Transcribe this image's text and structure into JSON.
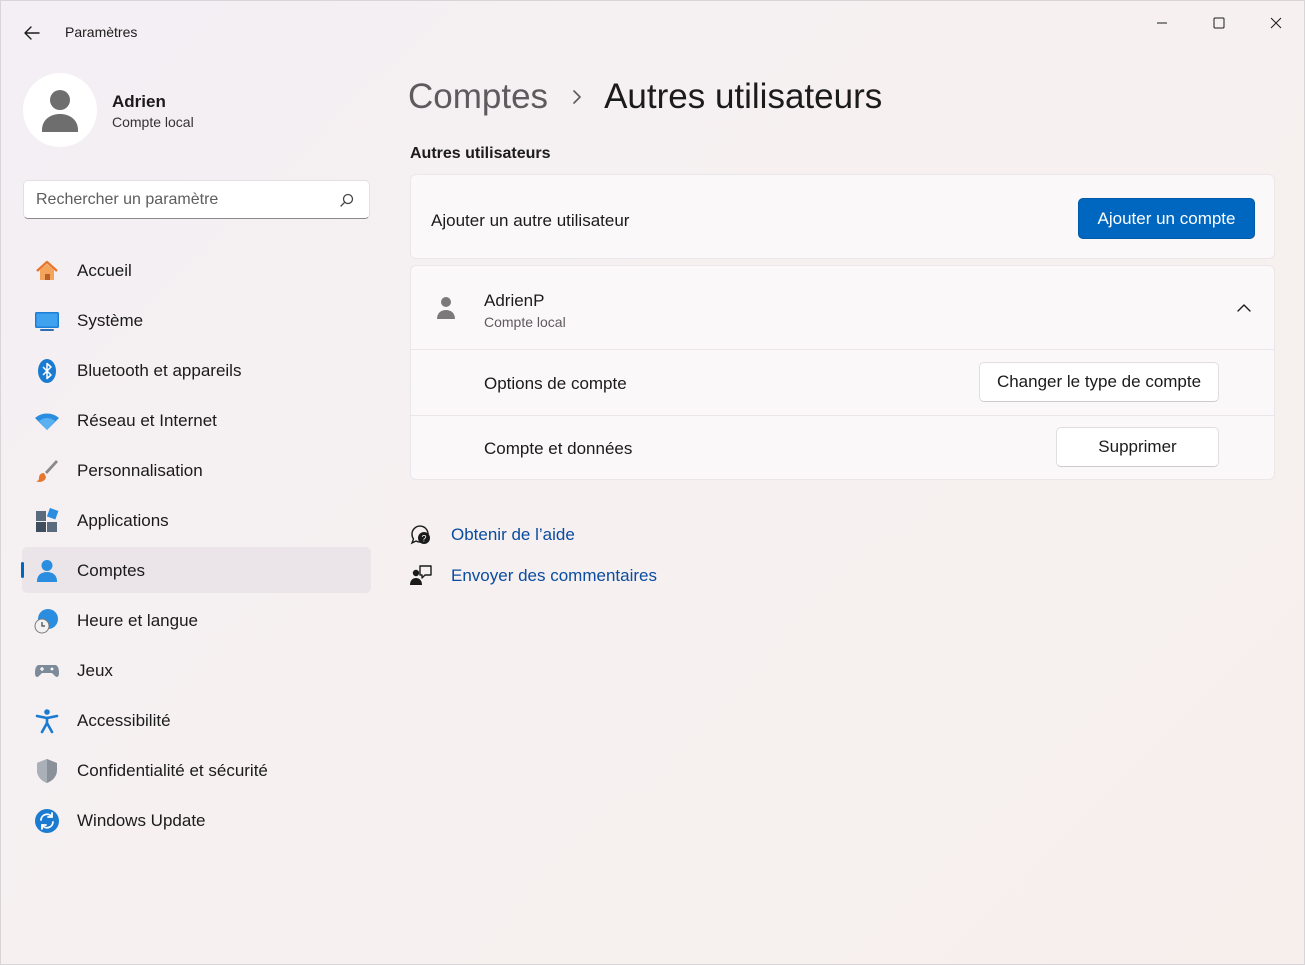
{
  "window": {
    "title": "Paramètres"
  },
  "profile": {
    "name": "Adrien",
    "account_type": "Compte local"
  },
  "search": {
    "placeholder": "Rechercher un paramètre",
    "value": ""
  },
  "sidebar": {
    "items": [
      {
        "label": "Accueil",
        "icon": "home-icon"
      },
      {
        "label": "Système",
        "icon": "system-icon"
      },
      {
        "label": "Bluetooth et appareils",
        "icon": "bluetooth-icon"
      },
      {
        "label": "Réseau et Internet",
        "icon": "wifi-icon"
      },
      {
        "label": "Personnalisation",
        "icon": "brush-icon"
      },
      {
        "label": "Applications",
        "icon": "apps-icon"
      },
      {
        "label": "Comptes",
        "icon": "accounts-icon",
        "active": true
      },
      {
        "label": "Heure et langue",
        "icon": "time-language-icon"
      },
      {
        "label": "Jeux",
        "icon": "gamepad-icon"
      },
      {
        "label": "Accessibilité",
        "icon": "accessibility-icon"
      },
      {
        "label": "Confidentialité et sécurité",
        "icon": "shield-icon"
      },
      {
        "label": "Windows Update",
        "icon": "windows-update-icon"
      }
    ]
  },
  "breadcrumb": {
    "parent": "Comptes",
    "current": "Autres utilisateurs"
  },
  "main": {
    "section_title": "Autres utilisateurs",
    "add_user": {
      "label": "Ajouter un autre utilisateur",
      "button": "Ajouter un compte"
    },
    "user": {
      "name": "AdrienP",
      "account_type": "Compte local",
      "options_label": "Options de compte",
      "options_button": "Changer le type de compte",
      "data_label": "Compte et données",
      "data_button": "Supprimer"
    },
    "help": {
      "get_help": "Obtenir de l’aide",
      "feedback": "Envoyer des commentaires"
    }
  },
  "colors": {
    "accent": "#0067c0",
    "link": "#0a4ca0"
  }
}
